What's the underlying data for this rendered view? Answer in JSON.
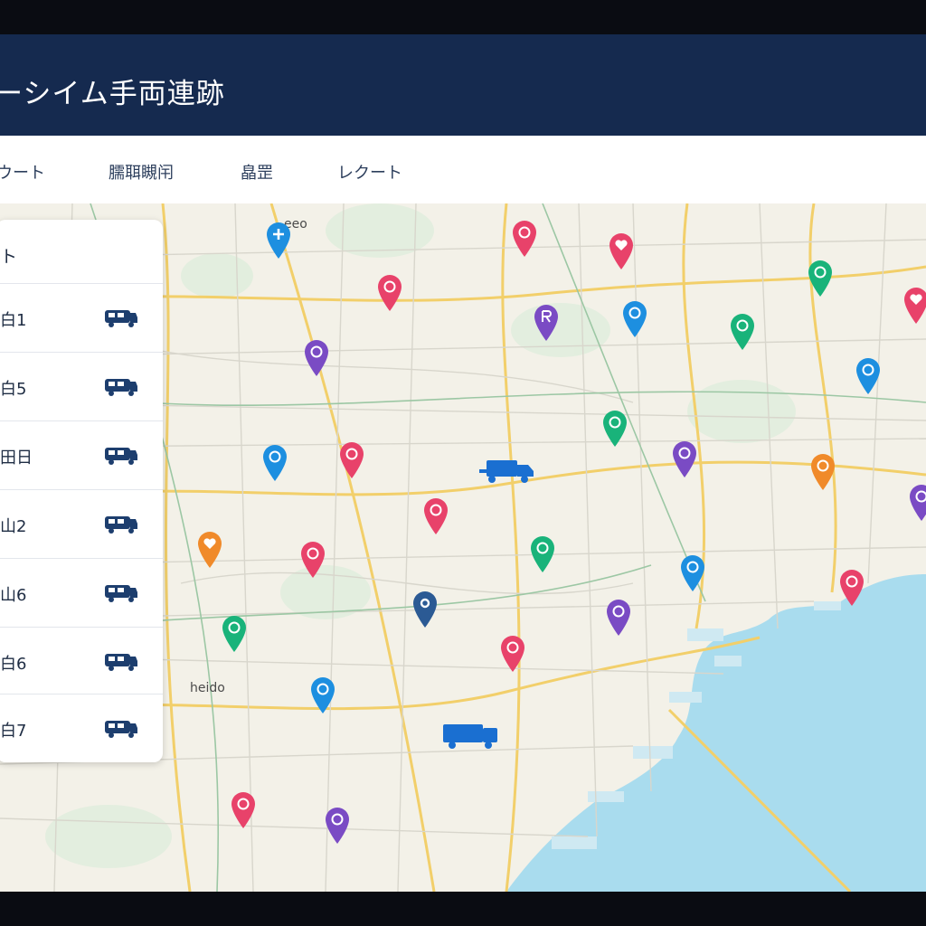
{
  "header": {
    "title": "ーシイム手両連跡"
  },
  "tabs": [
    {
      "label": "ウート"
    },
    {
      "label": "臑聑瞡闬"
    },
    {
      "label": "皛罡"
    },
    {
      "label": "レクート"
    }
  ],
  "panel": {
    "title": "ト",
    "vehicles": [
      {
        "label": "白1"
      },
      {
        "label": "白5"
      },
      {
        "label": "田日"
      },
      {
        "label": "山2"
      },
      {
        "label": "山6"
      },
      {
        "label": "白6"
      },
      {
        "label": "白7"
      }
    ]
  },
  "map_labels": {
    "top": "eeo",
    "left": "heido"
  },
  "colors": {
    "header_bg": "#152a4f",
    "accent_blue": "#1a6fd1",
    "pin_red": "#e8426a",
    "pin_purple": "#7a4bc4",
    "pin_blue": "#1d8fe0",
    "pin_green": "#19b37a",
    "pin_orange": "#f08a2a",
    "pin_navy": "#2b5a94",
    "water": "#a9dcee"
  },
  "pins": [
    {
      "color": "blue",
      "icon": "plus-icon"
    },
    {
      "color": "red",
      "icon": "info-icon"
    },
    {
      "color": "red",
      "icon": "heart-icon"
    },
    {
      "color": "red",
      "icon": "info-icon"
    },
    {
      "color": "purple",
      "icon": "r-icon"
    },
    {
      "color": "blue",
      "icon": "info-icon"
    },
    {
      "color": "green",
      "icon": "info-icon"
    },
    {
      "color": "green",
      "icon": "info-icon"
    },
    {
      "color": "red",
      "icon": "heart-icon"
    },
    {
      "color": "purple",
      "icon": "info-icon"
    },
    {
      "color": "blue",
      "icon": "info-icon"
    },
    {
      "color": "green",
      "icon": "info-icon"
    },
    {
      "color": "purple",
      "icon": "info-icon"
    },
    {
      "color": "orange",
      "icon": "info-icon"
    },
    {
      "color": "purple",
      "icon": "info-icon"
    },
    {
      "color": "blue",
      "icon": "info-icon"
    },
    {
      "color": "red",
      "icon": "info-icon"
    },
    {
      "color": "red",
      "icon": "info-icon"
    },
    {
      "color": "green",
      "icon": "info-icon"
    },
    {
      "color": "orange",
      "icon": "heart-icon"
    },
    {
      "color": "red",
      "icon": "info-icon"
    },
    {
      "color": "blue",
      "icon": "info-icon"
    },
    {
      "color": "red",
      "icon": "info-icon"
    },
    {
      "color": "navy",
      "icon": "dot-icon"
    },
    {
      "color": "purple",
      "icon": "info-icon"
    },
    {
      "color": "green",
      "icon": "info-icon"
    },
    {
      "color": "red",
      "icon": "info-icon"
    },
    {
      "color": "blue",
      "icon": "info-icon"
    },
    {
      "color": "red",
      "icon": "info-icon"
    },
    {
      "color": "purple",
      "icon": "info-icon"
    }
  ]
}
